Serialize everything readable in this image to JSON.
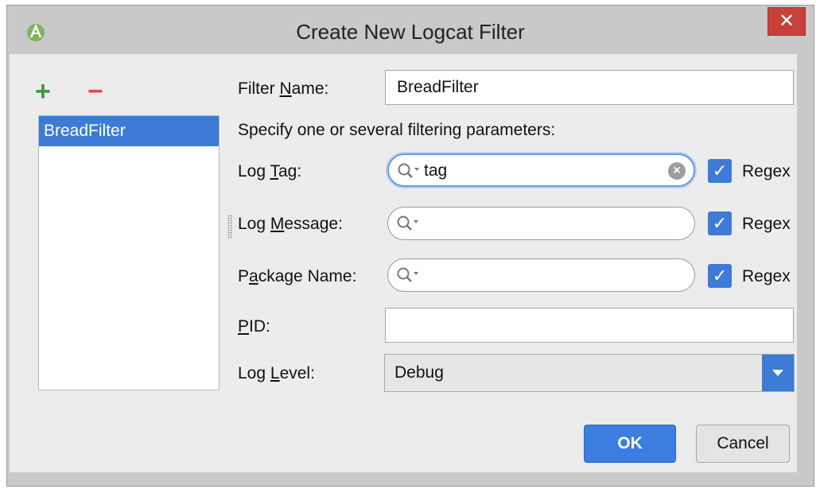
{
  "window": {
    "title": "Create New Logcat Filter",
    "close_label": "✕"
  },
  "filters_panel": {
    "add_glyph": "+",
    "remove_glyph": "−",
    "items": [
      "BreadFilter"
    ]
  },
  "form": {
    "filter_name": {
      "label_pre": "Filter ",
      "label_key": "N",
      "label_post": "ame:",
      "value": "BreadFilter"
    },
    "hint": "Specify one or several filtering parameters:",
    "log_tag": {
      "label_pre": "Log ",
      "label_key": "T",
      "label_post": "ag:",
      "value": "tag",
      "regex": "Regex"
    },
    "log_message": {
      "label_pre": "Log ",
      "label_key": "M",
      "label_post": "essage:",
      "value": "",
      "regex": "Regex"
    },
    "package_name": {
      "label_pre": "P",
      "label_key": "a",
      "label_post": "ckage Name:",
      "value": "",
      "regex": "Regex"
    },
    "pid": {
      "label_pre": "",
      "label_key": "P",
      "label_post": "ID:",
      "value": ""
    },
    "log_level": {
      "label_pre": "Log ",
      "label_key": "L",
      "label_post": "evel:",
      "value": "Debug"
    }
  },
  "buttons": {
    "ok": "OK",
    "cancel": "Cancel"
  },
  "colors": {
    "accent": "#3d7bd6",
    "add": "#3d9b3d",
    "remove": "#d35252",
    "close": "#c7403a"
  },
  "icons": {
    "app": "android-studio-icon",
    "search": "search-icon",
    "clear": "clear-icon",
    "dropdown": "chevron-down-icon"
  }
}
